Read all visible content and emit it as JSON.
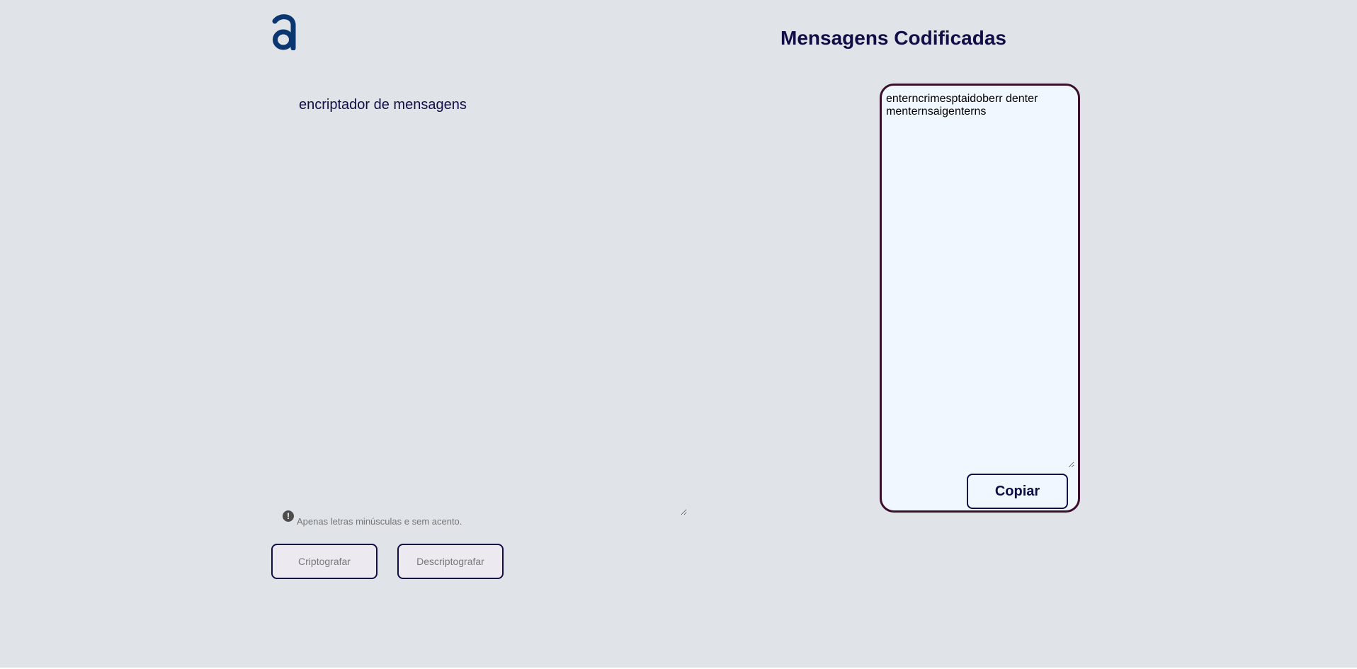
{
  "header": {
    "logo_icon": "alura-a-logo-icon",
    "title": "Mensagens Codificadas"
  },
  "input": {
    "value": "encriptador de mensagens",
    "hint_icon": "exclamation-circle-icon",
    "hint_symbol": "!",
    "hint": "Apenas letras minúsculas e sem acento."
  },
  "actions": {
    "encrypt_label": "Criptografar",
    "decrypt_label": "Descriptografar"
  },
  "result": {
    "output": "enterncrimesptaidoberr denter menternsaigenterns",
    "copy_label": "Copiar"
  },
  "colors": {
    "background": "#e0e4e8",
    "primary": "#110d45",
    "logo_blue": "#0b3670",
    "panel_border": "#3a0f2c",
    "panel_background": "#f1f7ff"
  }
}
